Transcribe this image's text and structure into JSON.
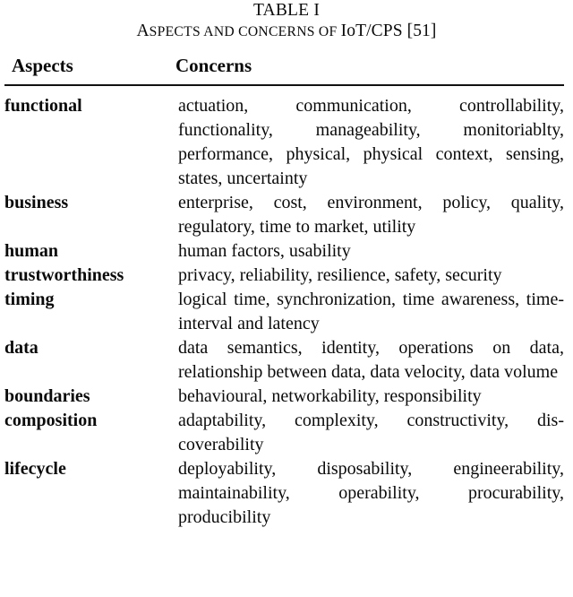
{
  "caption": {
    "table_number": "TABLE I",
    "title_prefix_letter": "A",
    "title_rest": "spects and concerns of ",
    "title_acronym": "IoT/CPS [51]",
    "title_full": "ASPECTS AND CONCERNS OF IoT/CPS [51]"
  },
  "table": {
    "columns": [
      {
        "key": "aspect",
        "label": "Aspects"
      },
      {
        "key": "concern",
        "label": "Concerns"
      }
    ],
    "rows": [
      {
        "aspect": "functional",
        "concerns": "actuation, communication, controllability, functionality, manageability, monitoriablty, performance, physical, physical context, sensing, states, uncertainty"
      },
      {
        "aspect": "business",
        "concerns": "enterprise, cost, environment, policy, quality, regulatory, time to market, utility"
      },
      {
        "aspect": "human",
        "concerns": "human factors, usability"
      },
      {
        "aspect": "trustworthiness",
        "concerns": "privacy, reliability, resilience, safety, security"
      },
      {
        "aspect": "timing",
        "concerns": "logical time, synchronization, time aware­ness, time-interval and latency"
      },
      {
        "aspect": "data",
        "concerns": "data semantics, identity, operations on data, relationship between data, data velocity, data volume"
      },
      {
        "aspect": "boundaries",
        "concerns": "behavioural, networkability, responsibility"
      },
      {
        "aspect": "composition",
        "concerns": "adaptability, complexity, constructivity, dis­coverability"
      },
      {
        "aspect": "lifecycle",
        "concerns": "deployability, disposability, engineerability, maintainability, operability, procurability, producibility"
      }
    ]
  },
  "colors": {
    "text": "#0a0a0a",
    "rule": "#111111",
    "background": "#ffffff"
  }
}
